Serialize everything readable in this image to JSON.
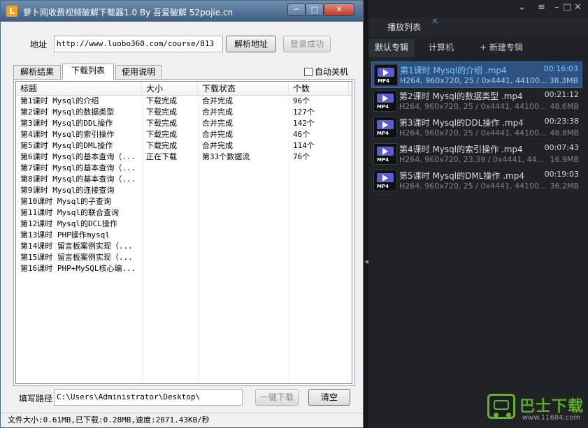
{
  "window": {
    "logo_letter": "L",
    "title": "萝卜网收费视频破解下载器1.0 By 吾爱破解 52pojie.cn",
    "min_glyph": "─",
    "max_glyph": "□",
    "close_glyph": "✕"
  },
  "address": {
    "label": "地址",
    "value": "http://www.luobo360.com/course/813",
    "parse_button": "解析地址",
    "login_button": "登录成功"
  },
  "tabs": {
    "parse_result": "解析结果",
    "download_list": "下载列表",
    "help": "使用说明"
  },
  "auto_shutdown": {
    "label": "自动关机",
    "checked": false
  },
  "list": {
    "headers": [
      "标题",
      "大小",
      "下载状态",
      "个数"
    ],
    "rows": [
      [
        "第1课时 Mysql的介绍",
        "下载完成",
        "合并完成",
        "96个"
      ],
      [
        "第2课时 Mysql的数据类型",
        "下载完成",
        "合并完成",
        "127个"
      ],
      [
        "第3课时 Mysql的DDL操作",
        "下载完成",
        "合并完成",
        "142个"
      ],
      [
        "第4课时 Mysql的索引操作",
        "下载完成",
        "合并完成",
        "46个"
      ],
      [
        "第5课时 Mysql的DML操作",
        "下载完成",
        "合并完成",
        "114个"
      ],
      [
        "第6课时 Mysql的基本查询（...",
        "正在下载",
        "第33个数据流",
        "76个"
      ],
      [
        "第7课时 Mysql的基本查询（...",
        "",
        "",
        ""
      ],
      [
        "第8课时 Mysql的基本查询（...",
        "",
        "",
        ""
      ],
      [
        "第9课时 Mysql的连接查询",
        "",
        "",
        ""
      ],
      [
        "第10课时 Mysql的子查询",
        "",
        "",
        ""
      ],
      [
        "第11课时 Mysql的联合查询",
        "",
        "",
        ""
      ],
      [
        "第12课时 Mysql的DCL操作",
        "",
        "",
        ""
      ],
      [
        "第13课时 PHP操作mysql",
        "",
        "",
        ""
      ],
      [
        "第14课时 留言板案例实现（...",
        "",
        "",
        ""
      ],
      [
        "第15课时 留言板案例实现（...",
        "",
        "",
        ""
      ],
      [
        "第16课时 PHP+MySQL核心编...",
        "",
        "",
        ""
      ]
    ]
  },
  "path": {
    "label": "填写路径",
    "value": "C:\\Users\\Administrator\\Desktop\\",
    "onekey_button": "一键下载",
    "clear_button": "清空"
  },
  "status": "文件大小:0.61MB,已下载:0.28MB,速度:2071.43KB/秒",
  "player": {
    "controls": {
      "down": "⌄",
      "menu": "≡",
      "min": "–",
      "full": "□",
      "close": "✕"
    },
    "playlist_title": "播放列表",
    "pin_icon": "⇱",
    "album_tabs": [
      "默认专辑",
      "计算机",
      "+ 新建专辑"
    ],
    "items": [
      {
        "title": "第1课时 Mysql的介绍  .mp4",
        "duration": "00:16:03",
        "info": "H264, 960x720, 25 / 0x4441, 44100Hz, 2...",
        "size": "38.3MB",
        "selected": true
      },
      {
        "title": "第2课时 Mysql的数据类型  .mp4",
        "duration": "00:21:12",
        "info": "H264, 960x720, 25 / 0x4441, 44100Hz, 2...",
        "size": "48.6MB",
        "selected": false
      },
      {
        "title": "第3课时 Mysql的DDL操作  .mp4",
        "duration": "00:23:38",
        "info": "H264, 960x720, 25 / 0x4441, 44100Hz, 2...",
        "size": "48.8MB",
        "selected": false
      },
      {
        "title": "第4课时 Mysql的索引操作  .mp4",
        "duration": "00:07:43",
        "info": "H264, 960x720, 23.39 / 0x4441, 44100Hz, ...",
        "size": "16.9MB",
        "selected": false
      },
      {
        "title": "第5课时 Mysql的DML操作  .mp4",
        "duration": "00:19:03",
        "info": "H264, 960x720, 25 / 0x4441, 44100Hz, 2...",
        "size": "36.2MB",
        "selected": false
      }
    ],
    "thumb_tag": "MP4"
  },
  "watermark": {
    "text": "巴士下载",
    "url": "www.11684.com"
  }
}
